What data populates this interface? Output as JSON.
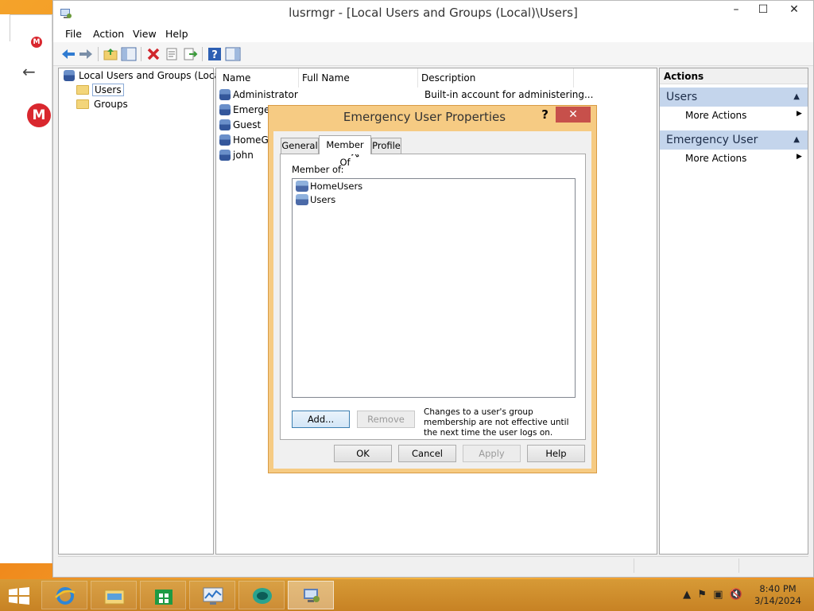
{
  "window": {
    "title": "lusrmgr - [Local Users and Groups (Local)\\Users]"
  },
  "menu": [
    "File",
    "Action",
    "View",
    "Help"
  ],
  "tree": {
    "root": "Local Users and Groups (Local)",
    "children": [
      "Users",
      "Groups"
    ]
  },
  "list": {
    "columns": [
      "Name",
      "Full Name",
      "Description"
    ],
    "rows": [
      {
        "name": "Administrator",
        "description": "Built-in account for administering..."
      },
      {
        "name": "Emerge"
      },
      {
        "name": "Guest"
      },
      {
        "name": "HomeG"
      },
      {
        "name": "john"
      }
    ]
  },
  "actions": {
    "header": "Actions",
    "sections": [
      {
        "title": "Users",
        "link": "More Actions"
      },
      {
        "title": "Emergency User",
        "link": "More Actions"
      }
    ]
  },
  "dialog": {
    "title": "Emergency User Properties",
    "help_glyph": "?",
    "tabs": [
      "General",
      "Member Of",
      "Profile"
    ],
    "active_tab": "Member Of",
    "member_of_label": "Member of:",
    "groups": [
      "HomeUsers",
      "Users"
    ],
    "add_label": "Add...",
    "remove_label": "Remove",
    "note": "Changes to a user's group membership are not effective until the next time the user logs on.",
    "ok_label": "OK",
    "cancel_label": "Cancel",
    "apply_label": "Apply",
    "help_label": "Help"
  },
  "taskbar": {
    "time": "8:40 PM",
    "date": "3/14/2024"
  },
  "colors": {
    "dialog_frame": "#f6cb83",
    "close_red": "#c7504b",
    "action_section": "#c4d5ec",
    "desktop": "#f08a1c"
  },
  "icons": [
    "back-arrow-icon",
    "forward-arrow-icon",
    "up-folder-icon",
    "show-hide-tree-icon",
    "delete-icon",
    "properties-icon",
    "export-icon",
    "help-icon",
    "action-pane-icon",
    "user-icon",
    "group-icon",
    "folder-icon",
    "start-icon",
    "internet-explorer-icon",
    "file-explorer-icon",
    "store-icon",
    "performance-monitor-icon",
    "app-icon",
    "computer-management-icon"
  ]
}
